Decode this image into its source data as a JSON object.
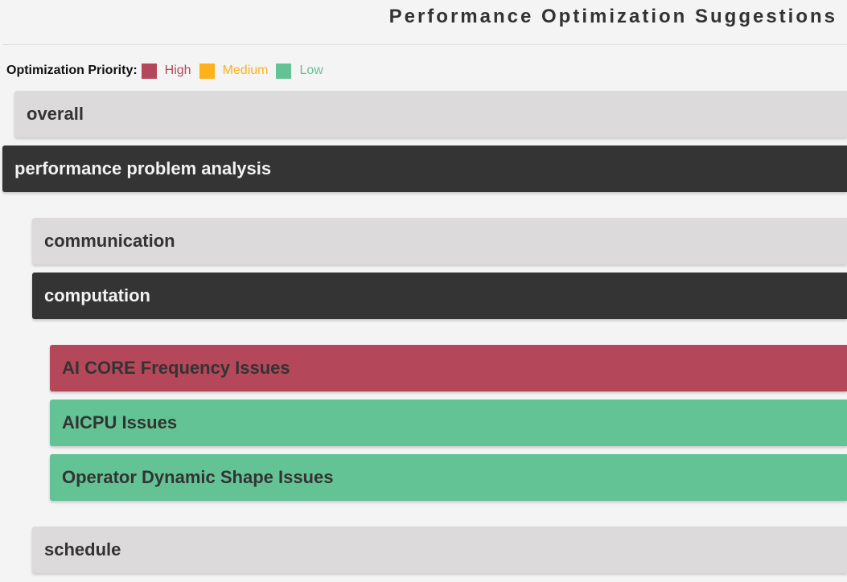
{
  "header": {
    "title": "Performance Optimization Suggestions"
  },
  "legend": {
    "title": "Optimization Priority:",
    "items": [
      {
        "label": "High",
        "color": "#b4485a"
      },
      {
        "label": "Medium",
        "color": "#fdb11b"
      },
      {
        "label": "Low",
        "color": "#64c394"
      }
    ]
  },
  "sections": {
    "overall": {
      "label": "overall",
      "state": "collapsed"
    },
    "performance_problem_analysis": {
      "label": "performance problem analysis",
      "state": "expanded",
      "children": {
        "communication": {
          "label": "communication",
          "state": "collapsed"
        },
        "computation": {
          "label": "computation",
          "state": "expanded",
          "issues": [
            {
              "label": "AI CORE Frequency Issues",
              "priority": "High"
            },
            {
              "label": "AICPU Issues",
              "priority": "Low"
            },
            {
              "label": "Operator Dynamic Shape Issues",
              "priority": "Low"
            }
          ]
        },
        "schedule": {
          "label": "schedule",
          "state": "collapsed"
        }
      }
    }
  },
  "colors": {
    "background": "#f4f4f4",
    "collapsed": "#dcdadb",
    "expanded": "#343434",
    "high": "#b4485a",
    "medium": "#fdb11b",
    "low": "#64c394"
  }
}
